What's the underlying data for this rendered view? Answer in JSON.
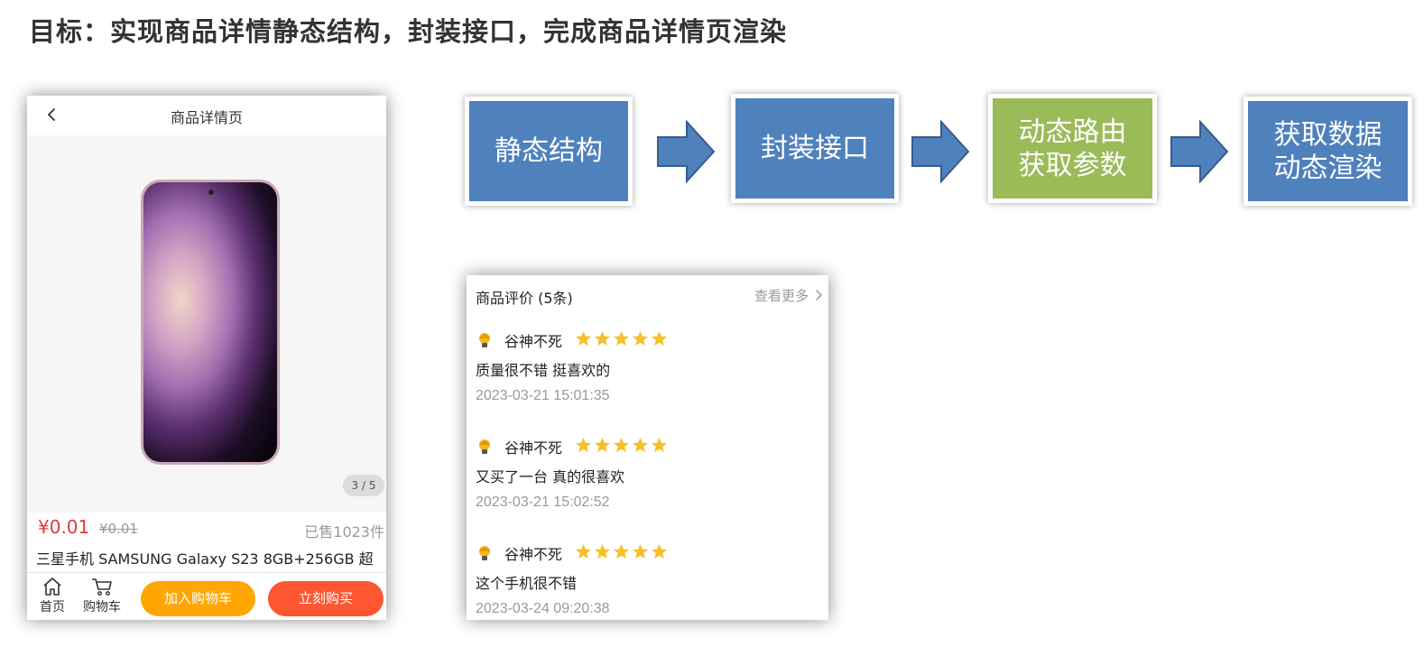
{
  "slide": {
    "title": "目标：实现商品详情静态结构，封装接口，完成商品详情页渲染"
  },
  "phone": {
    "nav_title": "商品详情页",
    "page_indicator": "3 / 5",
    "price": "¥0.01",
    "old_price": "¥0.01",
    "sold": "已售1023件",
    "product_name": "三星手机 SAMSUNG Galaxy S23 8GB+256GB 超",
    "tabbar": {
      "home_label": "首页",
      "cart_label": "购物车",
      "add_cart_label": "加入购物车",
      "buy_now_label": "立刻购买"
    },
    "colors": {
      "price": "#e4393c",
      "add_cart": "#ffa600",
      "buy_now": "#fe5630"
    }
  },
  "flow": {
    "steps": [
      {
        "line1": "静态结构",
        "line2": "",
        "color": "#4f81bd"
      },
      {
        "line1": "封装接口",
        "line2": "",
        "color": "#4f81bd"
      },
      {
        "line1": "动态路由",
        "line2": "获取参数",
        "color": "#9bbb59"
      },
      {
        "line1": "获取数据",
        "line2": "动态渲染",
        "color": "#4f81bd"
      }
    ],
    "arrow_color": "#4f81bd"
  },
  "reviews": {
    "title": "商品评价 (5条)",
    "more": "查看更多",
    "star_color": "#f7c02b",
    "items": [
      {
        "user": "谷神不死",
        "rating": 5,
        "content": "质量很不错 挺喜欢的",
        "time": "2023-03-21 15:01:35"
      },
      {
        "user": "谷神不死",
        "rating": 5,
        "content": "又买了一台 真的很喜欢",
        "time": "2023-03-21 15:02:52"
      },
      {
        "user": "谷神不死",
        "rating": 5,
        "content": "这个手机很不错",
        "time": "2023-03-24 09:20:38"
      }
    ]
  }
}
